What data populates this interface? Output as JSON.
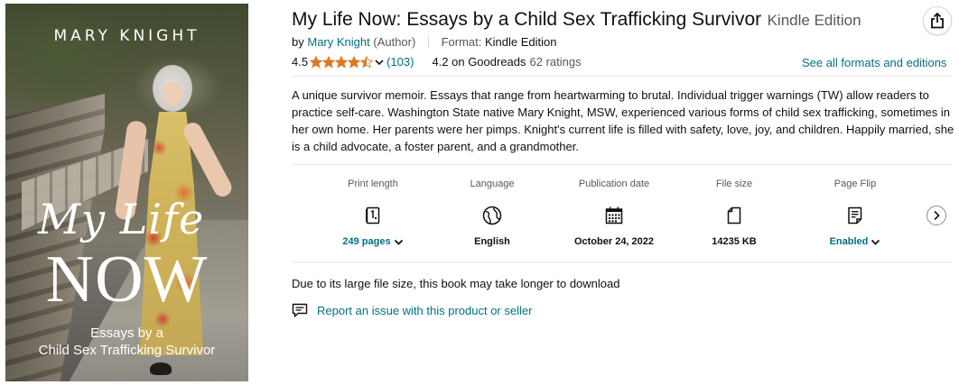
{
  "cover": {
    "author": "MARY KNIGHT",
    "title_script": "My Life",
    "title_main": "NOW",
    "subtitle_line1": "Essays by a",
    "subtitle_line2": "Child Sex Trafficking Survivor"
  },
  "product": {
    "title": "My Life Now: Essays by a Child Sex Trafficking Survivor",
    "edition": "Kindle Edition",
    "by": "by",
    "author": "Mary Knight",
    "author_role": "(Author)",
    "format_label": "Format:",
    "format_value": "Kindle Edition"
  },
  "rating": {
    "value": "4.5",
    "stars": 4.5,
    "count": "(103)",
    "goodreads": "4.2 on Goodreads",
    "goodreads_count": "62 ratings",
    "star_color": "#de7921",
    "see_all": "See all formats and editions"
  },
  "description": "A unique survivor memoir. Essays that range from heartwarming to brutal. Individual trigger warnings (TW) allow readers to practice self-care. Washington State native Mary Knight, MSW, experienced various forms of child sex trafficking, sometimes in her own home. Her parents were her pimps. Knight's current life is filled with safety, love, joy, and children. Happily married, she is a child advocate, a foster parent, and a grandmother.",
  "details": [
    {
      "label": "Print length",
      "icon": "book-pages-icon",
      "value": "249 pages",
      "link": true
    },
    {
      "label": "Language",
      "icon": "globe-icon",
      "value": "English",
      "link": false
    },
    {
      "label": "Publication date",
      "icon": "calendar-icon",
      "value": "October 24, 2022",
      "link": false
    },
    {
      "label": "File size",
      "icon": "file-icon",
      "value": "14235 KB",
      "link": false
    },
    {
      "label": "Page Flip",
      "icon": "page-flip-icon",
      "value": "Enabled",
      "link": true
    }
  ],
  "note": "Due to its large file size, this book may take longer to download",
  "report": "Report an issue with this product or seller",
  "colors": {
    "link": "#007185",
    "text": "#0f1111",
    "muted": "#565959"
  }
}
